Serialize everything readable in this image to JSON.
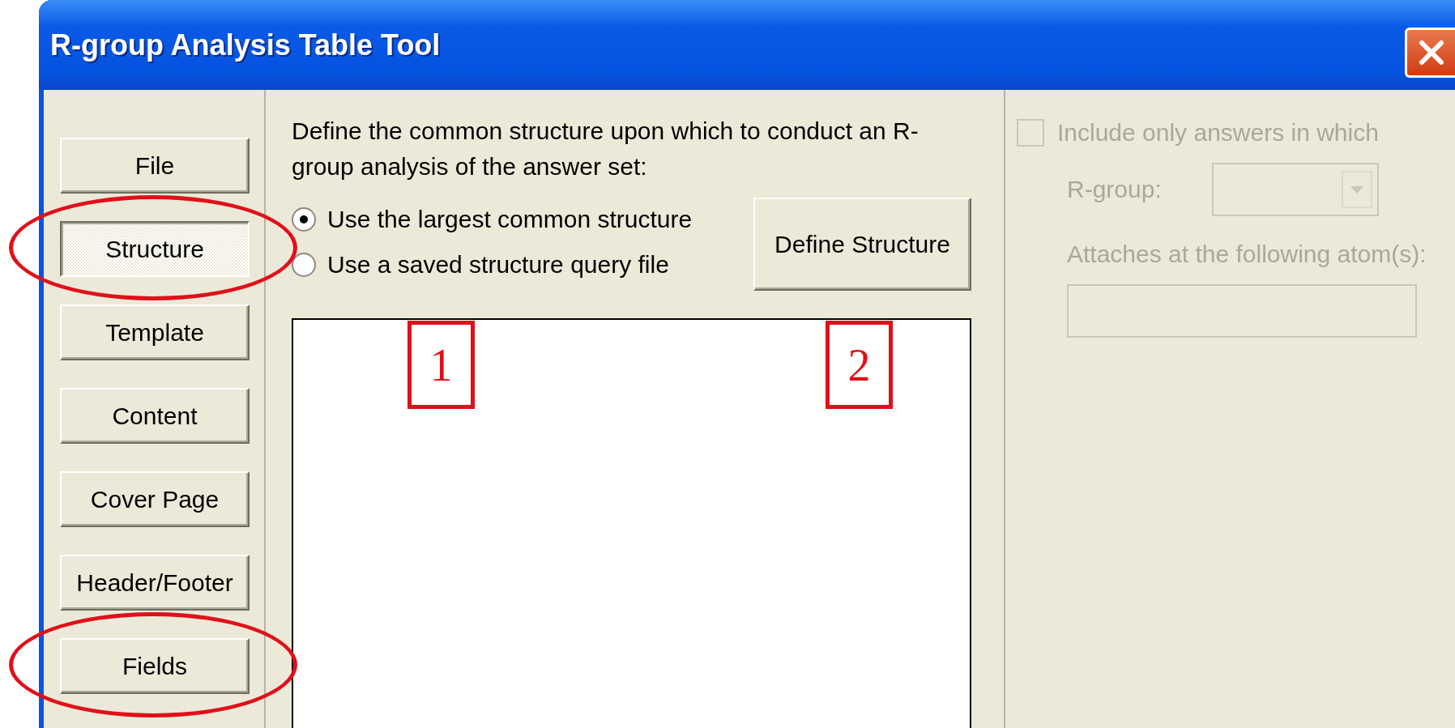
{
  "window": {
    "title": "R-group Analysis Table Tool"
  },
  "nav": [
    {
      "label": "File",
      "selected": false,
      "circled": false
    },
    {
      "label": "Structure",
      "selected": true,
      "circled": true
    },
    {
      "label": "Template",
      "selected": false,
      "circled": false
    },
    {
      "label": "Content",
      "selected": false,
      "circled": false
    },
    {
      "label": "Cover Page",
      "selected": false,
      "circled": false
    },
    {
      "label": "Header/Footer",
      "selected": false,
      "circled": false
    },
    {
      "label": "Fields",
      "selected": false,
      "circled": true
    }
  ],
  "instruction": "Define the common structure upon which to conduct an R-group analysis of the answer set:",
  "options": [
    {
      "label": "Use the largest common structure",
      "selected": true
    },
    {
      "label": "Use a saved structure query file",
      "selected": false
    }
  ],
  "define_button": "Define Structure",
  "callouts": [
    {
      "label": "1"
    },
    {
      "label": "2"
    }
  ],
  "filter": {
    "checkbox": {
      "label": "Include only answers in which",
      "checked": false,
      "disabled": true
    },
    "rgroup_label": "R-group:",
    "attach_label": "Attaches at the following atom(s):"
  }
}
